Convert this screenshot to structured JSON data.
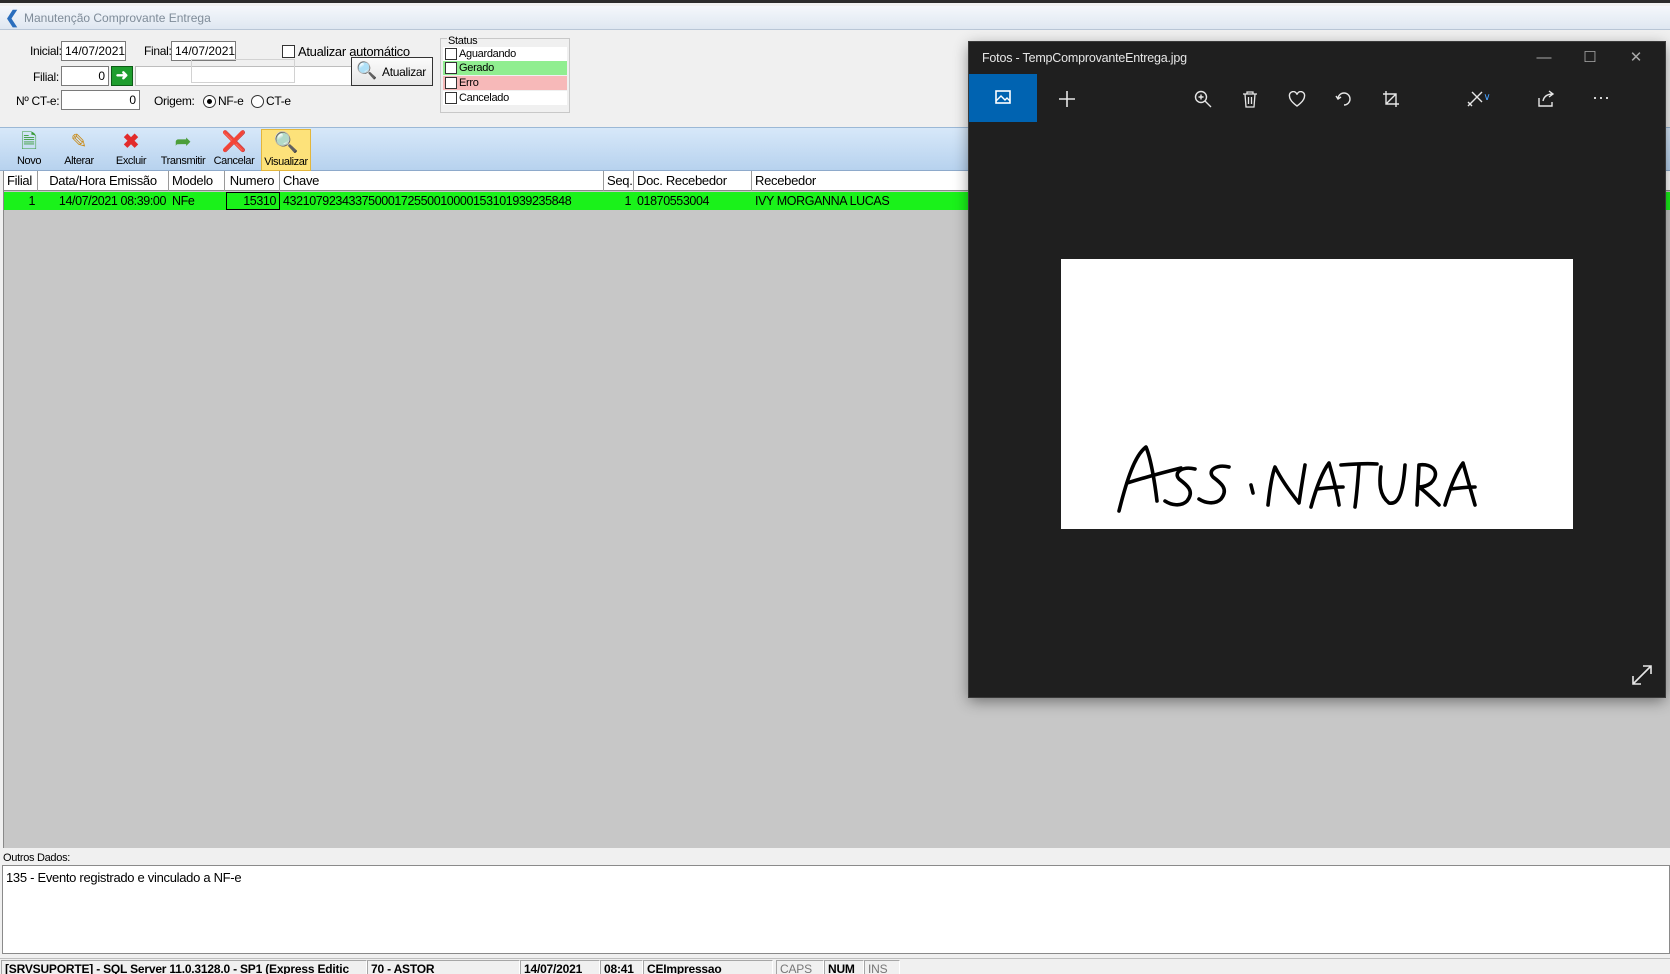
{
  "app": {
    "title": "Manutenção Comprovante Entrega"
  },
  "filters": {
    "inicial_label": "Inicial:",
    "inicial_value": "14/07/2021",
    "final_label": "Final:",
    "final_value": "14/07/2021",
    "auto_update_label": "Atualizar automático",
    "filial_label": "Filial:",
    "filial_value": "0",
    "filial_name": "",
    "ct_label": "Nº CT-e:",
    "ct_value": "0",
    "origem_label": "Origem:",
    "origem_options": [
      "NF-e",
      "CT-e"
    ],
    "origem_selected": "NF-e",
    "refresh_label": "Atualizar"
  },
  "status_group": {
    "legend": "Status",
    "items": [
      {
        "label": "Aguardando",
        "color": "#ffffff"
      },
      {
        "label": "Gerado",
        "color": "#90ee90"
      },
      {
        "label": "Erro",
        "color": "#f7b9b9"
      },
      {
        "label": "Cancelado",
        "color": "#ffffff"
      }
    ]
  },
  "toolbar": {
    "items": [
      {
        "label": "Novo",
        "icon": "new-document-icon"
      },
      {
        "label": "Alterar",
        "icon": "edit-icon"
      },
      {
        "label": "Excluir",
        "icon": "delete-x-icon"
      },
      {
        "label": "Transmitir",
        "icon": "transmit-icon"
      },
      {
        "label": "Cancelar",
        "icon": "cancel-circle-icon"
      },
      {
        "label": "Visualizar",
        "icon": "view-document-icon"
      }
    ],
    "active": "Visualizar"
  },
  "grid": {
    "columns": [
      "Filial",
      "Data/Hora Emissão",
      "Modelo",
      "Numero",
      "Chave",
      "Seq.",
      "Doc. Recebedor",
      "Recebedor"
    ],
    "rows": [
      {
        "filial": "1",
        "data_hora": "14/07/2021 08:39:00",
        "modelo": "NFe",
        "numero": "15310",
        "chave": "43210792343375000172550010000153101939235848",
        "seq": "1",
        "doc_recebedor": "01870553004",
        "recebedor": "IVY MORGANNA LUCAS",
        "status_color": "#1af21a"
      }
    ]
  },
  "other_data": {
    "label": "Outros Dados:",
    "text": "135 - Evento registrado e vinculado a NF-e"
  },
  "statusbar": {
    "server": "[SRVSUPORTE] - SQL Server 11.0.3128.0 - SP1 (Express Editic",
    "user": "70 - ASTOR",
    "date": "14/07/2021",
    "time": "08:41",
    "module": "CEImpressao",
    "caps": "CAPS",
    "num": "NUM",
    "ins": "INS"
  },
  "photos_window": {
    "title": "Fotos - TempComprovanteEntrega.jpg",
    "image_text": "ASSINATURA"
  }
}
